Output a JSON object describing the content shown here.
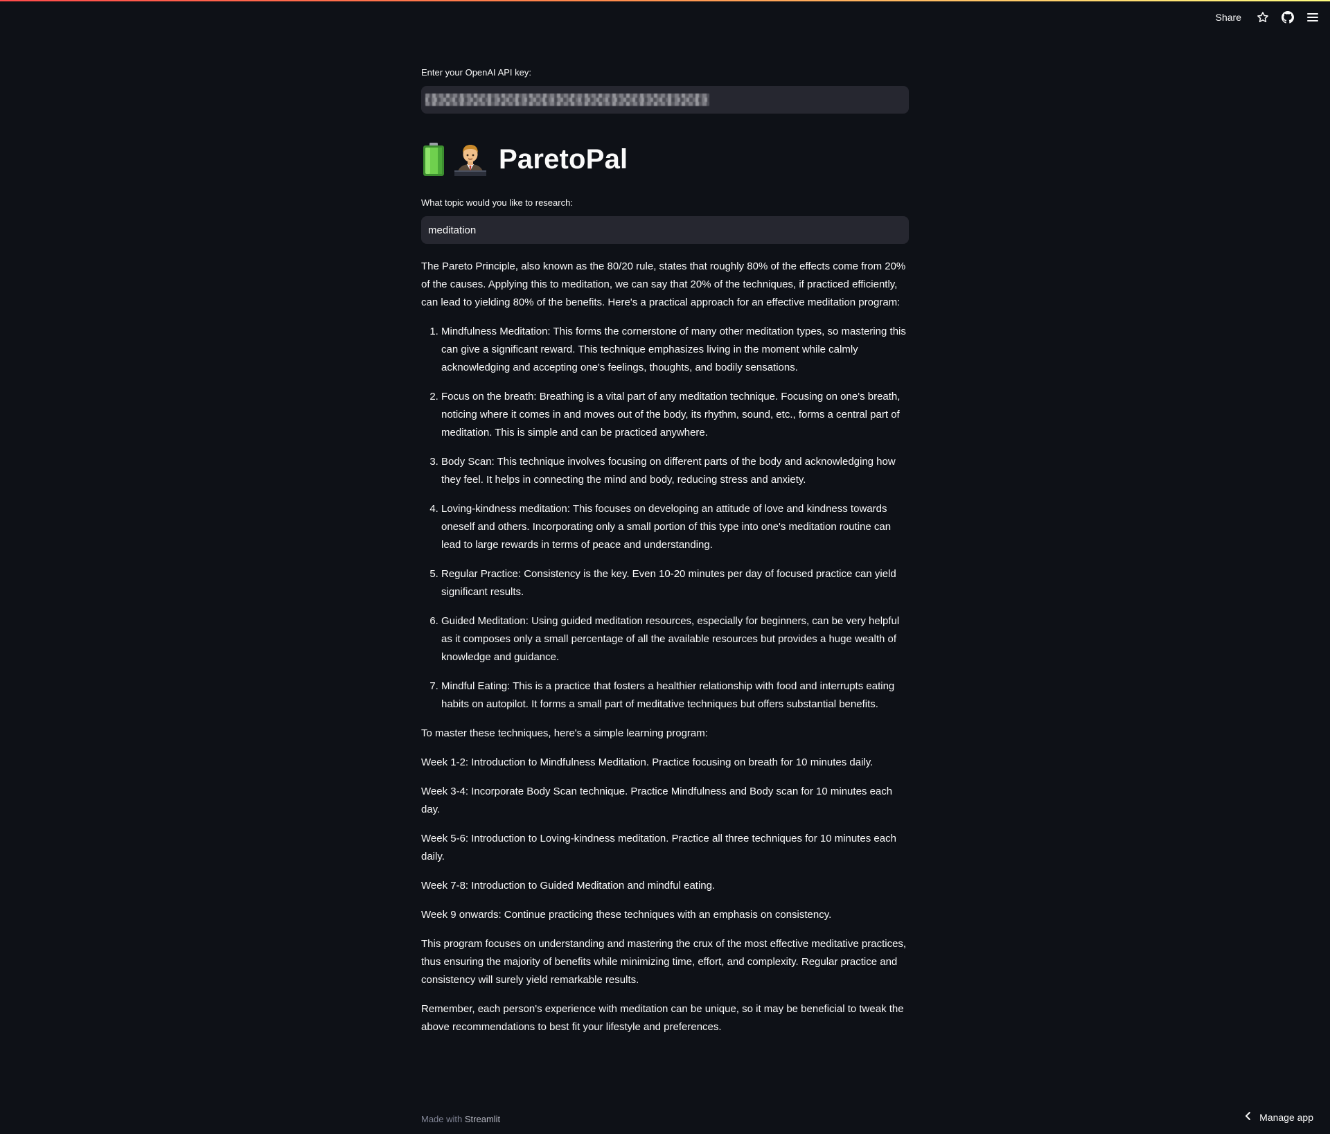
{
  "toolbar": {
    "share_label": "Share",
    "icons": [
      "star-icon",
      "github-icon",
      "hamburger-menu-icon"
    ]
  },
  "api_key": {
    "label": "Enter your OpenAI API key:",
    "value": ""
  },
  "title": {
    "text": "ParetoPal",
    "emojis": [
      "battery-icon",
      "office-worker-icon"
    ]
  },
  "topic": {
    "label": "What topic would you like to research:",
    "value": "meditation"
  },
  "response": {
    "intro": "The Pareto Principle, also known as the 80/20 rule, states that roughly 80% of the effects come from 20% of the causes. Applying this to meditation, we can say that 20% of the techniques, if practiced efficiently, can lead to yielding 80% of the benefits. Here's a practical approach for an effective meditation program:",
    "items": [
      "Mindfulness Meditation: This forms the cornerstone of many other meditation types, so mastering this can give a significant reward. This technique emphasizes living in the moment while calmly acknowledging and accepting one's feelings, thoughts, and bodily sensations.",
      "Focus on the breath: Breathing is a vital part of any meditation technique. Focusing on one's breath, noticing where it comes in and moves out of the body, its rhythm, sound, etc., forms a central part of meditation. This is simple and can be practiced anywhere.",
      "Body Scan: This technique involves focusing on different parts of the body and acknowledging how they feel. It helps in connecting the mind and body, reducing stress and anxiety.",
      "Loving-kindness meditation: This focuses on developing an attitude of love and kindness towards oneself and others. Incorporating only a small portion of this type into one's meditation routine can lead to large rewards in terms of peace and understanding.",
      "Regular Practice: Consistency is the key. Even 10-20 minutes per day of focused practice can yield significant results.",
      "Guided Meditation: Using guided meditation resources, especially for beginners, can be very helpful as it composes only a small percentage of all the available resources but provides a huge wealth of knowledge and guidance.",
      "Mindful Eating: This is a practice that fosters a healthier relationship with food and interrupts eating habits on autopilot. It forms a small part of meditative techniques but offers substantial benefits."
    ],
    "program_intro": "To master these techniques, here's a simple learning program:",
    "weeks": [
      "Week 1-2: Introduction to Mindfulness Meditation. Practice focusing on breath for 10 minutes daily.",
      "Week 3-4: Incorporate Body Scan technique. Practice Mindfulness and Body scan for 10 minutes each day.",
      "Week 5-6: Introduction to Loving-kindness meditation. Practice all three techniques for 10 minutes each daily.",
      "Week 7-8: Introduction to Guided Meditation and mindful eating.",
      "Week 9 onwards: Continue practicing these techniques with an emphasis on consistency."
    ],
    "summary": "This program focuses on understanding and mastering the crux of the most effective meditative practices, thus ensuring the majority of benefits while minimizing time, effort, and complexity. Regular practice and consistency will surely yield remarkable results.",
    "closing": "Remember, each person's experience with meditation can be unique, so it may be beneficial to tweak the above recommendations to best fit your lifestyle and preferences."
  },
  "footer": {
    "made_with": "Made with",
    "brand": "Streamlit",
    "manage_app": "Manage app"
  },
  "colors": {
    "background": "#0e1117",
    "input_background": "#262730",
    "text": "#fafafa",
    "muted": "#808495"
  }
}
